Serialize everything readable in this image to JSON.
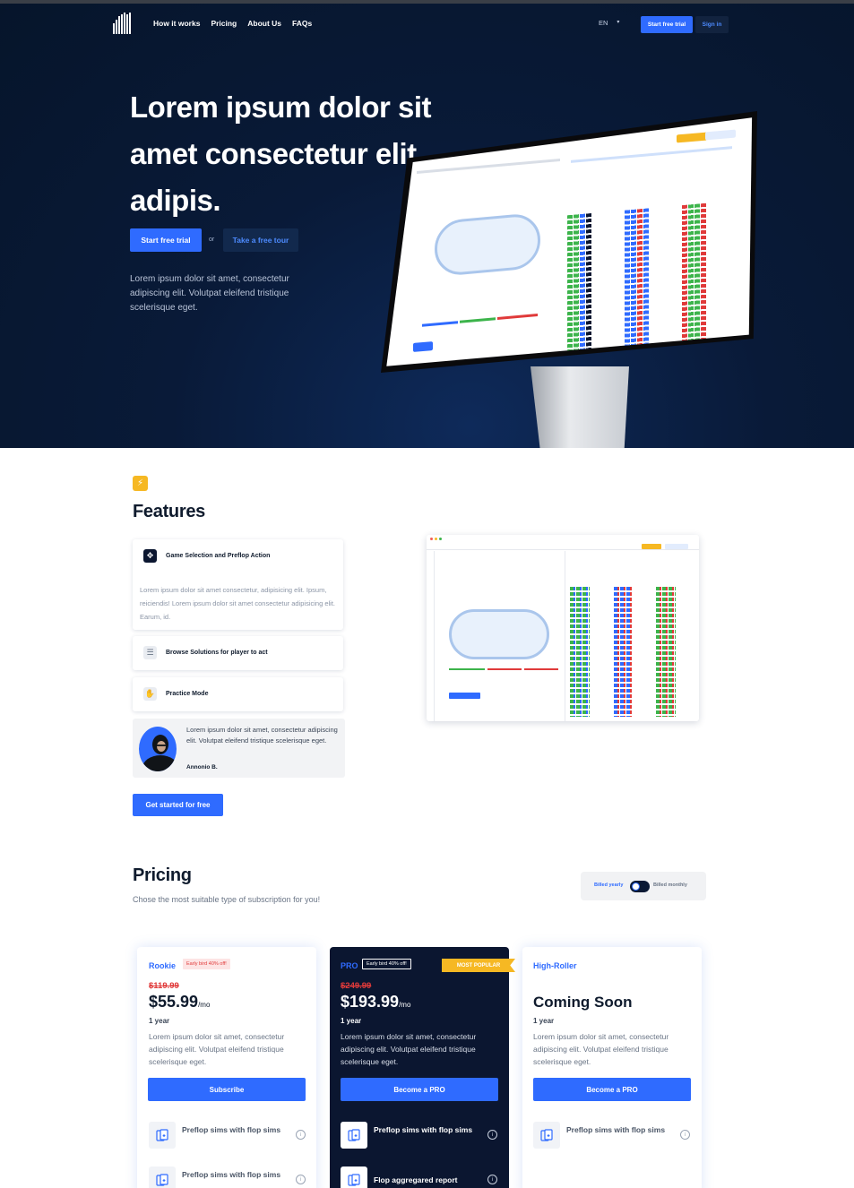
{
  "nav": {
    "links": [
      "How it works",
      "Pricing",
      "About Us",
      "FAQs"
    ],
    "language": "EN",
    "trial_button": "Start free trial",
    "signin_button": "Sign in"
  },
  "hero": {
    "title": "Lorem ipsum dolor sit amet consectetur elit adipis.",
    "start_button": "Start free trial",
    "or_label": "or",
    "tour_button": "Take a free tour",
    "description": "Lorem ipsum dolor sit amet, consectetur adipiscing elit. Volutpat eleifend tristique scelerisque eget."
  },
  "features": {
    "title": "Features",
    "items": [
      {
        "label": "Game Selection and Preflop Action",
        "icon": "move-icon",
        "body": "Lorem ipsum dolor sit amet consectetur, adipisicing elit. Ipsum, reiciendis! Lorem ipsum dolor sit amet consectetur adipisicing elit. Earum, id."
      },
      {
        "label": "Browse Solutions for player to act",
        "icon": "layers-icon"
      },
      {
        "label": "Practice Mode",
        "icon": "hand-icon"
      }
    ],
    "testimonial": {
      "text": "Lorem ipsum dolor sit amet, consectetur adipiscing elit. Volutpat eleifend tristique scelerisque eget.",
      "author": "Annonio B."
    },
    "cta": "Get started for free"
  },
  "pricing": {
    "title": "Pricing",
    "subtitle": "Chose the most suitable type of subscription for you!",
    "billing": {
      "yearly": "Billed yearly",
      "monthly": "Billed monthly"
    },
    "plans": [
      {
        "name": "Rookie",
        "tag": "Early bird 40% off!",
        "old_price": "$119.99",
        "price": "$55.99",
        "unit": "/mo",
        "period": "1 year",
        "desc": "Lorem ipsum dolor sit amet, consectetur adipiscing elit. Volutpat eleifend tristique scelerisque eget.",
        "button": "Subscribe",
        "features": [
          "Preflop sims with flop sims",
          "Preflop sims with flop sims"
        ]
      },
      {
        "name": "PRO",
        "tag": "Early bird 40% off!",
        "popular": "MOST POPULAR",
        "old_price": "$249.99",
        "price": "$193.99",
        "unit": "/mo",
        "period": "1 year",
        "desc": "Lorem ipsum dolor sit amet, consectetur adipiscing elit. Volutpat eleifend tristique scelerisque eget.",
        "button": "Become a PRO",
        "features": [
          "Preflop sims with flop sims",
          "Flop aggregared report"
        ]
      },
      {
        "name": "High-Roller",
        "coming": "Coming Soon",
        "period": "1 year",
        "desc": "Lorem ipsum dolor sit amet, consectetur adipiscing elit. Volutpat eleifend tristique scelerisque eget.",
        "button": "Become a PRO",
        "features": [
          "Preflop sims with flop sims"
        ]
      }
    ]
  },
  "colors": {
    "accent": "#2f6bff",
    "hero_bg": "#06152b",
    "gold": "#f6b823",
    "red": "#e03a3a"
  }
}
